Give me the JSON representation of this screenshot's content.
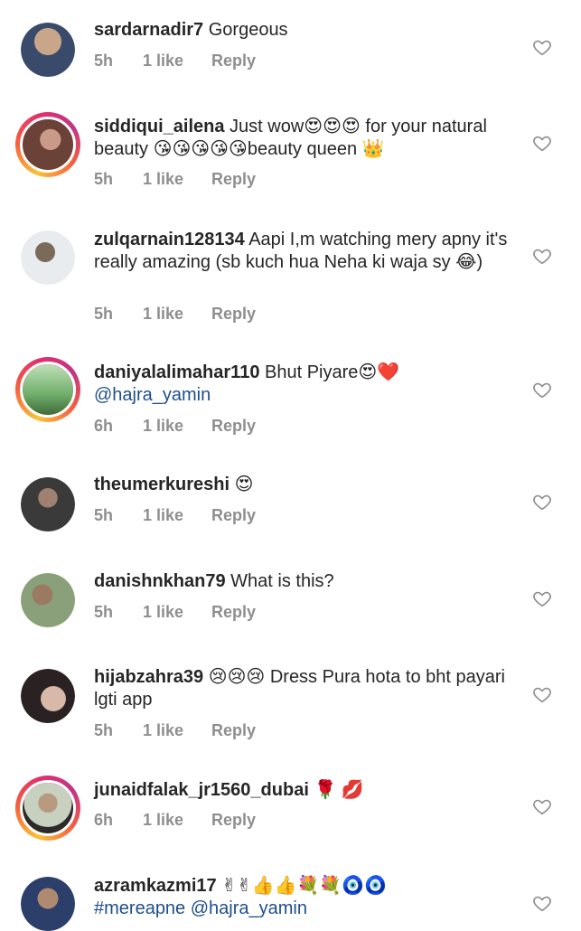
{
  "comments": [
    {
      "username": "sardarnadir7",
      "text": " Gorgeous",
      "mention": "",
      "time": "5h",
      "likes": "1 like",
      "reply": "Reply",
      "avatar_ring": false,
      "avatar_color": "#5b7fa8"
    },
    {
      "username": "siddiqui_ailena",
      "text": " Just wow😍😍😍 for your natural beauty 😘😘😘😘😘beauty queen 👑",
      "mention": "",
      "time": "5h",
      "likes": "1 like",
      "reply": "Reply",
      "avatar_ring": true,
      "avatar_color": "#8a5a4a"
    },
    {
      "username": "zulqarnain128134",
      "text": " Aapi I,m watching mery apny it's really amazing (sb kuch hua Neha ki waja sy 😂)",
      "mention": "",
      "time": "5h",
      "likes": "1 like",
      "reply": "Reply",
      "avatar_ring": false,
      "avatar_color": "#9aa3a8"
    },
    {
      "username": "daniyalalimahar110",
      "text": " Bhut Piyare😍❤️",
      "mention": "@hajra_yamin",
      "time": "6h",
      "likes": "1 like",
      "reply": "Reply",
      "avatar_ring": true,
      "avatar_color": "#6fae6a"
    },
    {
      "username": "theumerkureshi",
      "text": " 😍",
      "mention": "",
      "time": "5h",
      "likes": "1 like",
      "reply": "Reply",
      "avatar_ring": false,
      "avatar_color": "#4a4a4a"
    },
    {
      "username": "danishnkhan79",
      "text": " What is this?",
      "mention": "",
      "time": "5h",
      "likes": "1 like",
      "reply": "Reply",
      "avatar_ring": false,
      "avatar_color": "#7a9a6a"
    },
    {
      "username": "hijabzahra39",
      "text": " 😢😢😢 Dress Pura hota to bht payari lgti app",
      "mention": "",
      "time": "5h",
      "likes": "1 like",
      "reply": "Reply",
      "avatar_ring": false,
      "avatar_color": "#5a4a4a"
    },
    {
      "username": "junaidfalak_jr1560_dubai",
      "text": " 🌹 💋",
      "mention": "",
      "time": "6h",
      "likes": "1 like",
      "reply": "Reply",
      "avatar_ring": true,
      "avatar_color": "#a8b098"
    },
    {
      "username": "azramkazmi17",
      "text": " ✌✌👍👍💐💐🧿🧿",
      "mention": "#mereapne @hajra_yamin",
      "time": "",
      "likes": "",
      "reply": "",
      "avatar_ring": false,
      "avatar_color": "#6a7a98"
    }
  ]
}
